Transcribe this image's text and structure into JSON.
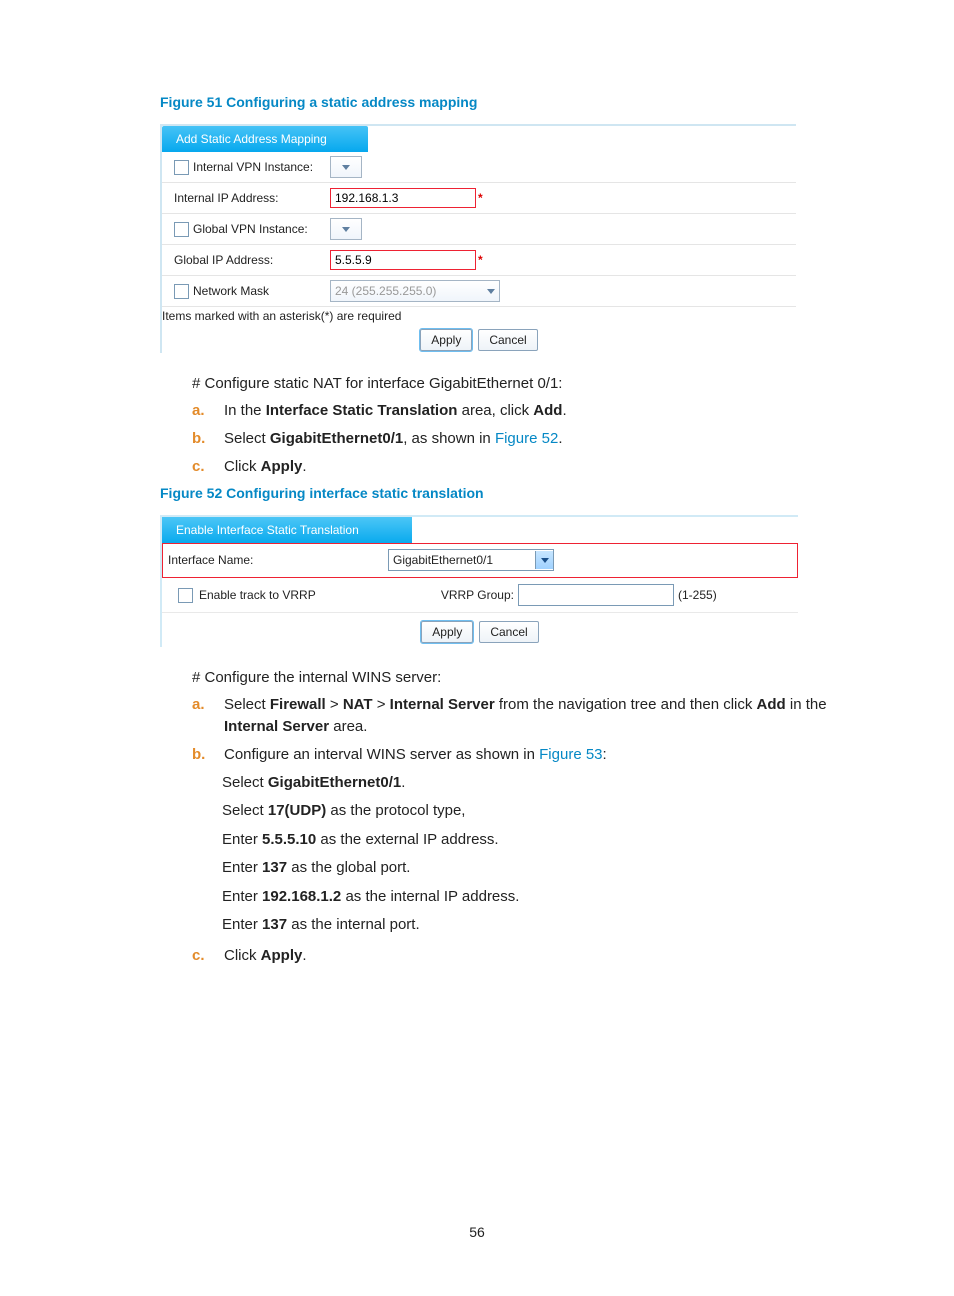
{
  "fig51": {
    "title": "Figure 51 Configuring a static address mapping",
    "header": "Add Static Address Mapping",
    "rows": {
      "internal_vpn_lbl": "Internal VPN Instance:",
      "internal_ip_lbl": "Internal IP Address:",
      "internal_ip_val": "192.168.1.3",
      "global_vpn_lbl": "Global VPN Instance:",
      "global_ip_lbl": "Global IP Address:",
      "global_ip_val": "5.5.5.9",
      "netmask_lbl": "Network Mask",
      "netmask_val": "24 (255.255.255.0)"
    },
    "note": "Items marked with an asterisk(*) are required",
    "apply": "Apply",
    "cancel": "Cancel"
  },
  "text1": "# Configure static NAT for interface GigabitEthernet 0/1:",
  "list1": {
    "a": {
      "k": "a.",
      "t1": "In the ",
      "b1": "Interface Static Translation",
      "t2": " area, click ",
      "b2": "Add",
      "t3": "."
    },
    "b": {
      "k": "b.",
      "t1": "Select ",
      "b1": "GigabitEthernet0/1",
      "t2": ", as shown in ",
      "l": "Figure 52",
      "t3": "."
    },
    "c": {
      "k": "c.",
      "t1": "Click ",
      "b1": "Apply",
      "t2": "."
    }
  },
  "fig52": {
    "title": "Figure 52 Configuring interface static translation",
    "header": "Enable Interface Static Translation",
    "ifname_lbl": "Interface Name:",
    "ifname_val": "GigabitEthernet0/1",
    "vrrp_chk_lbl": "Enable track to VRRP",
    "vrrp_grp_lbl": "VRRP Group:",
    "vrrp_hint": "(1-255)",
    "apply": "Apply",
    "cancel": "Cancel"
  },
  "text2": "# Configure the internal WINS server:",
  "list2": {
    "a": {
      "k": "a.",
      "t1": "Select ",
      "b1": "Firewall",
      "t2": " > ",
      "b2": "NAT",
      "t3": " > ",
      "b3": "Internal Server",
      "t4": " from the navigation tree and then click ",
      "b4": "Add",
      "t5": " in the ",
      "b5": "Internal Server",
      "t6": " area."
    },
    "b": {
      "k": "b.",
      "t1": "Configure an interval WINS server as shown in ",
      "l": "Figure 53",
      "t2": ":"
    },
    "c": {
      "k": "c.",
      "t1": "Click ",
      "b1": "Apply",
      "t2": "."
    }
  },
  "sub": {
    "s1a": "Select ",
    "s1b": "GigabitEthernet0/1",
    "s1c": ".",
    "s2a": "Select ",
    "s2b": "17(UDP)",
    "s2c": " as the protocol type,",
    "s3a": "Enter ",
    "s3b": "5.5.5.10",
    "s3c": " as the external IP address.",
    "s4a": "Enter ",
    "s4b": "137",
    "s4c": " as the global port.",
    "s5a": "Enter ",
    "s5b": "192.168.1.2",
    "s5c": " as the internal IP address.",
    "s6a": "Enter ",
    "s6b": "137",
    "s6c": " as the internal port."
  },
  "pagenum": "56"
}
